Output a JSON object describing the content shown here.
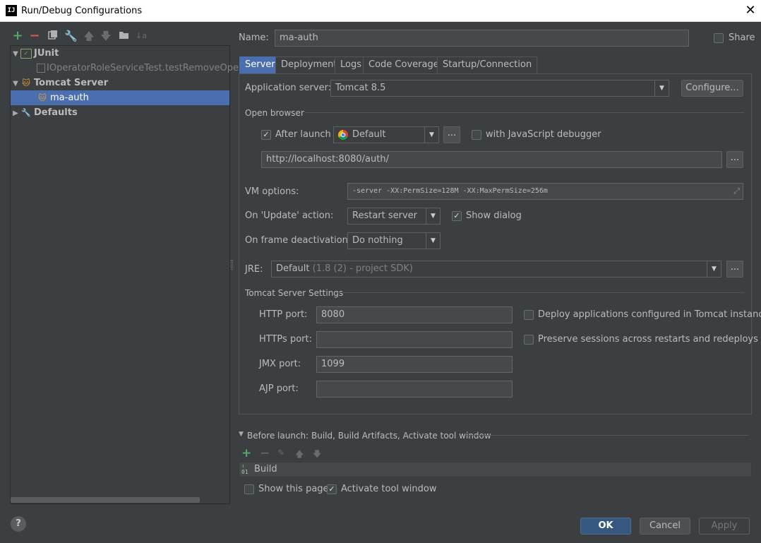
{
  "window": {
    "title": "Run/Debug Configurations",
    "app_icon": "IJ"
  },
  "toolbar": {
    "icons": [
      "add-icon",
      "remove-icon",
      "copy-icon",
      "wrench-icon",
      "move-up-icon",
      "move-down-icon",
      "folder-icon",
      "sort-icon"
    ]
  },
  "tree": {
    "junit": {
      "label": "JUnit",
      "child": "IOperatorRoleServiceTest.testRemoveOpera"
    },
    "tomcat": {
      "label": "Tomcat Server",
      "child": "ma-auth"
    },
    "defaults": {
      "label": "Defaults"
    }
  },
  "header": {
    "name_label": "Name:",
    "name_value": "ma-auth",
    "share_label": "Share"
  },
  "tabs": [
    "Server",
    "Deployment",
    "Logs",
    "Code Coverage",
    "Startup/Connection"
  ],
  "server": {
    "app_server_label": "Application server:",
    "app_server_value": "Tomcat 8.5",
    "configure_label": "Configure...",
    "open_browser_label": "Open browser",
    "after_launch_label": "After launch",
    "browser_value": "Default",
    "ellipsis": "...",
    "js_debugger_label": "with JavaScript debugger",
    "url_value": "http://localhost:8080/auth/",
    "vm_options_label": "VM options:",
    "vm_options_value": "-server -XX:PermSize=128M -XX:MaxPermSize=256m",
    "on_update_label": "On 'Update' action:",
    "on_update_value": "Restart server",
    "show_dialog_label": "Show dialog",
    "on_frame_label": "On frame deactivation:",
    "on_frame_value": "Do nothing",
    "jre_label": "JRE:",
    "jre_value": "Default",
    "jre_hint": "(1.8 (2) - project SDK)",
    "tomcat_settings_label": "Tomcat Server Settings",
    "http_port_label": "HTTP port:",
    "http_port_value": "8080",
    "https_port_label": "HTTPs port:",
    "https_port_value": "",
    "jmx_port_label": "JMX port:",
    "jmx_port_value": "1099",
    "ajp_port_label": "AJP port:",
    "ajp_port_value": "",
    "deploy_label": "Deploy applications configured in Tomcat instance",
    "preserve_label": "Preserve sessions across restarts and redeploys"
  },
  "before_launch": {
    "title": "Before launch: Build, Build Artifacts, Activate tool window",
    "item": "Build",
    "show_page_label": "Show this page",
    "activate_label": "Activate tool window"
  },
  "footer": {
    "ok": "OK",
    "cancel": "Cancel",
    "apply": "Apply",
    "help": "?"
  },
  "colors": {
    "accent": "#4b6eaf",
    "background": "#3c3f41",
    "field": "#45494a",
    "add_green": "#59a869",
    "remove_red": "#e05555"
  }
}
